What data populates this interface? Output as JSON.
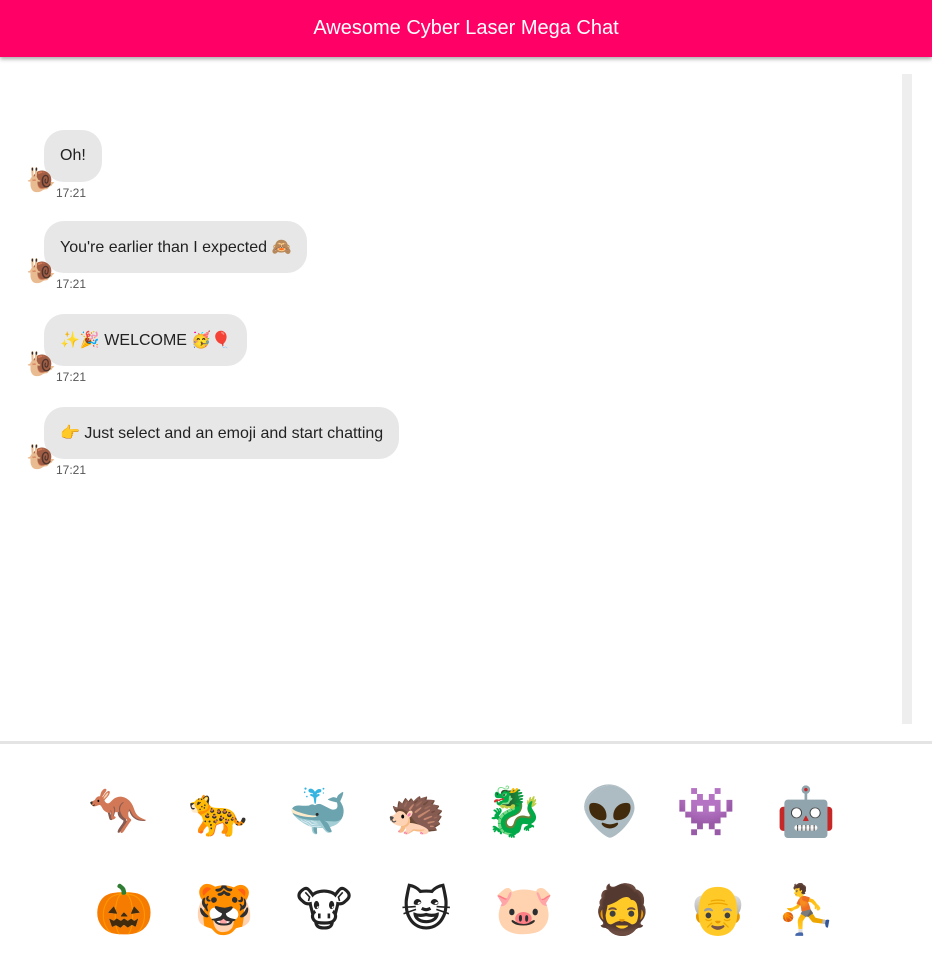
{
  "header": {
    "title": "Awesome Cyber Laser Mega Chat"
  },
  "messages": [
    {
      "text": "Oh!",
      "time": "17:21",
      "avatar": "🐌"
    },
    {
      "text": "You're earlier than I expected 🙈",
      "time": "17:21",
      "avatar": "🐌"
    },
    {
      "text": "✨🎉 WELCOME 🥳🎈",
      "time": "17:21",
      "avatar": "🐌"
    },
    {
      "text": "👉 Just select and an emoji and start chatting",
      "time": "17:21",
      "avatar": "🐌"
    }
  ],
  "emoji_picker": {
    "row1": [
      "🦘",
      "🐆",
      "🐳",
      "🦔",
      "🐉",
      "👽",
      "👾",
      "🤖"
    ],
    "row2": [
      "🎃",
      "🐯",
      "🐮",
      "😺",
      "🐷",
      "🧔",
      "👴",
      "⛹"
    ]
  },
  "colors": {
    "header_bg": "#ff0066",
    "bubble_bg": "#e7e7e7"
  }
}
